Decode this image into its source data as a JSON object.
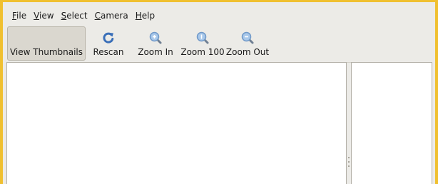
{
  "menubar": {
    "items": [
      {
        "accel": "F",
        "rest": "ile"
      },
      {
        "accel": "V",
        "rest": "iew"
      },
      {
        "accel": "S",
        "rest": "elect"
      },
      {
        "accel": "C",
        "rest": "amera"
      },
      {
        "accel": "H",
        "rest": "elp"
      }
    ]
  },
  "toolbar": {
    "view_thumbnails": "View Thumbnails",
    "rescan": "Rescan",
    "zoom_in": "Zoom In",
    "zoom_100": "Zoom 100",
    "zoom_out": "Zoom Out"
  },
  "colors": {
    "window_border": "#f0c030",
    "toolbar_bg": "#ecebe7",
    "pane_bg": "#ffffff",
    "refresh_icon": "#3a6fb8",
    "zoom_icon": "#7aa6d8"
  },
  "icons": {
    "rescan": "refresh-icon",
    "zoom_in": "zoom-in-icon",
    "zoom_100": "zoom-100-icon",
    "zoom_out": "zoom-out-icon"
  }
}
